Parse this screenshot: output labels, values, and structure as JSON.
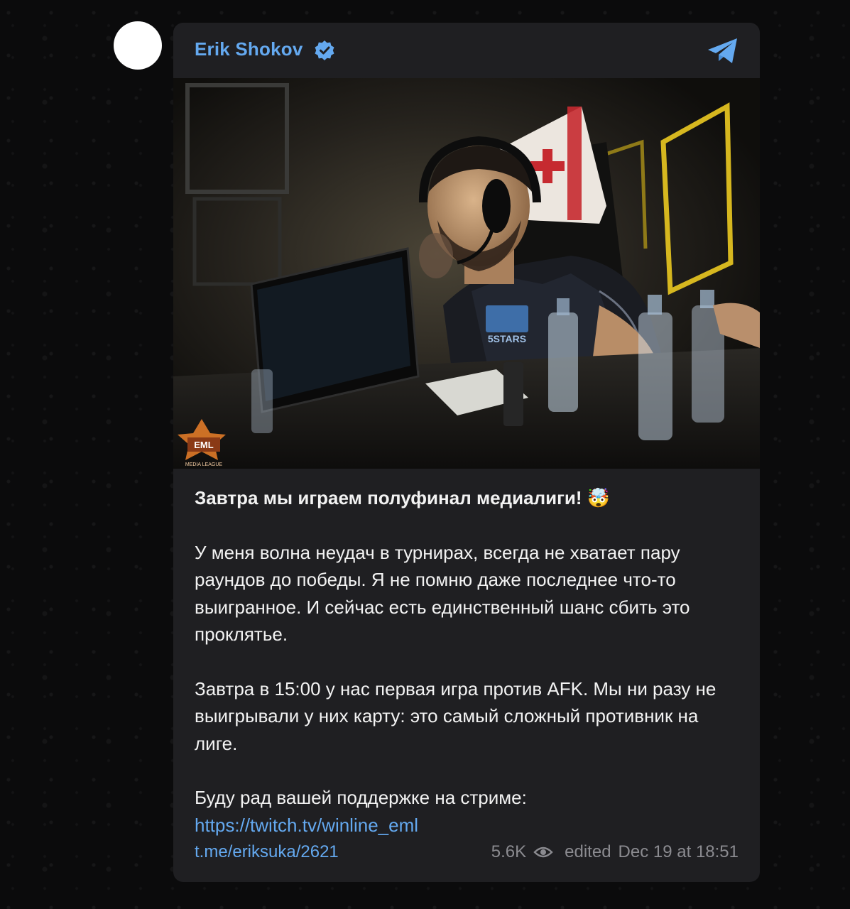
{
  "post": {
    "author": "Erik Shokov",
    "verified": true,
    "icons": {
      "verified": "verified-badge-icon",
      "channel": "telegram-icon",
      "views": "eye-icon"
    },
    "photo": {
      "logo_text_1": "EML",
      "logo_text_2": "MEDIA LEAGUE",
      "jersey_text": "5STARS"
    },
    "headline": "Завтра мы играем полуфинал медиалиги! 🤯",
    "paragraph_1": "У меня волна неудач в турнирах, всегда не хватает пару раундов до победы. Я не помню даже последнее что-то выигранное. И сейчас есть единственный шанс сбить это проклятье.",
    "paragraph_2": "Завтра в 15:00 у нас первая игра против AFK. Мы ни разу не выигрывали у них карту: это самый сложный противник на лиге.",
    "paragraph_3": "Буду рад вашей поддержке на стриме:",
    "stream_link": "https://twitch.tv/winline_eml",
    "post_link": "t.me/eriksuka/2621",
    "views": "5.6K",
    "edited_label": "edited",
    "timestamp": "Dec 19 at 18:51"
  },
  "colors": {
    "link": "#64a9f0",
    "card_bg": "#1f1f22",
    "page_bg": "#0b0b0c"
  }
}
